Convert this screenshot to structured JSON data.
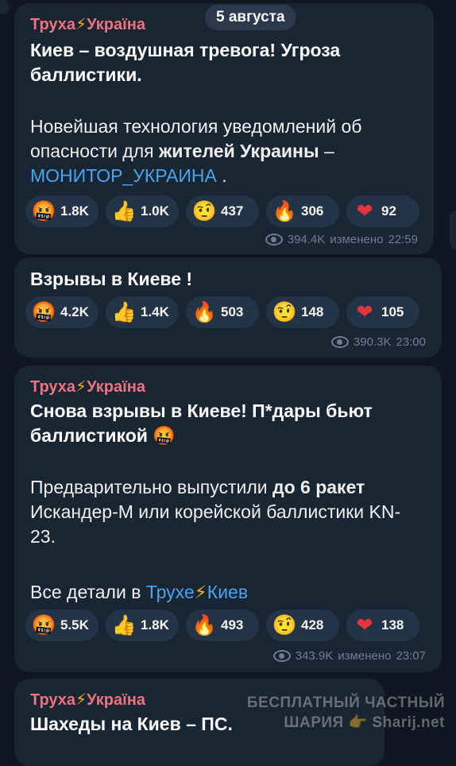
{
  "date_divider": "5 августа",
  "messages": [
    {
      "channel": "Труха⚡Україна",
      "title": "Киев – воздушная тревога! Угроза баллистики.",
      "body_pre": "Новейшая технология уведомлений об опасности для ",
      "body_bold": "жителей Украины",
      "body_mid": " – ",
      "link": "МОНИТОР_УКРАИНА",
      "body_end": " .",
      "reactions": [
        {
          "icon": "cursing-face-icon",
          "glyph": "🤬",
          "count": "1.8K"
        },
        {
          "icon": "thumbs-up-icon",
          "glyph": "👍",
          "count": "1.0K"
        },
        {
          "icon": "raised-eyebrow-face-icon",
          "glyph": "🤨",
          "count": "437"
        },
        {
          "icon": "fire-icon",
          "glyph": "🔥",
          "count": "306"
        },
        {
          "icon": "heart-icon",
          "glyph": "❤",
          "count": "92"
        }
      ],
      "views": "394.4K",
      "edited": "изменено",
      "time": "22:59"
    },
    {
      "title": "Взрывы в Киеве !",
      "reactions": [
        {
          "icon": "cursing-face-icon",
          "glyph": "🤬",
          "count": "4.2K"
        },
        {
          "icon": "thumbs-up-icon",
          "glyph": "👍",
          "count": "1.4K"
        },
        {
          "icon": "fire-icon",
          "glyph": "🔥",
          "count": "503"
        },
        {
          "icon": "raised-eyebrow-face-icon",
          "glyph": "🤨",
          "count": "148"
        },
        {
          "icon": "heart-icon",
          "glyph": "❤",
          "count": "105"
        }
      ],
      "views": "390.3K",
      "time": "23:00"
    },
    {
      "channel": "Труха⚡Україна",
      "title": "Снова взрывы в Киеве! П*дары бьют баллистикой",
      "title_emoji": "🤬",
      "body1_pre": "Предварительно выпустили ",
      "body1_bold": "до 6 ракет",
      "body1_end": " Искандер-М или корейской баллистики KN-23.",
      "body2_pre": "Все детали в ",
      "body2_link": "Трухе⚡Киев",
      "reactions": [
        {
          "icon": "cursing-face-icon",
          "glyph": "🤬",
          "count": "5.5K"
        },
        {
          "icon": "thumbs-up-icon",
          "glyph": "👍",
          "count": "1.8K"
        },
        {
          "icon": "fire-icon",
          "glyph": "🔥",
          "count": "493"
        },
        {
          "icon": "raised-eyebrow-face-icon",
          "glyph": "🤨",
          "count": "428"
        },
        {
          "icon": "heart-icon",
          "glyph": "❤",
          "count": "138"
        }
      ],
      "views": "343.9K",
      "edited": "изменено",
      "time": "23:07"
    },
    {
      "channel": "Труха⚡Україна",
      "title": "Шахеды на Киев – ПС."
    }
  ],
  "watermark": {
    "line1": "БЕСПЛАТНЫЙ ЧАСТНЫЙ",
    "line2": "ШАРИЯ",
    "line2_icon": "👉",
    "line2_site": "Sharij.net"
  },
  "colors": {
    "background": "#0e1621",
    "bubble": "#182533",
    "chip": "#233447",
    "channel": "#f0727f",
    "link": "#4aa3ee",
    "meta": "#6e7f91"
  }
}
